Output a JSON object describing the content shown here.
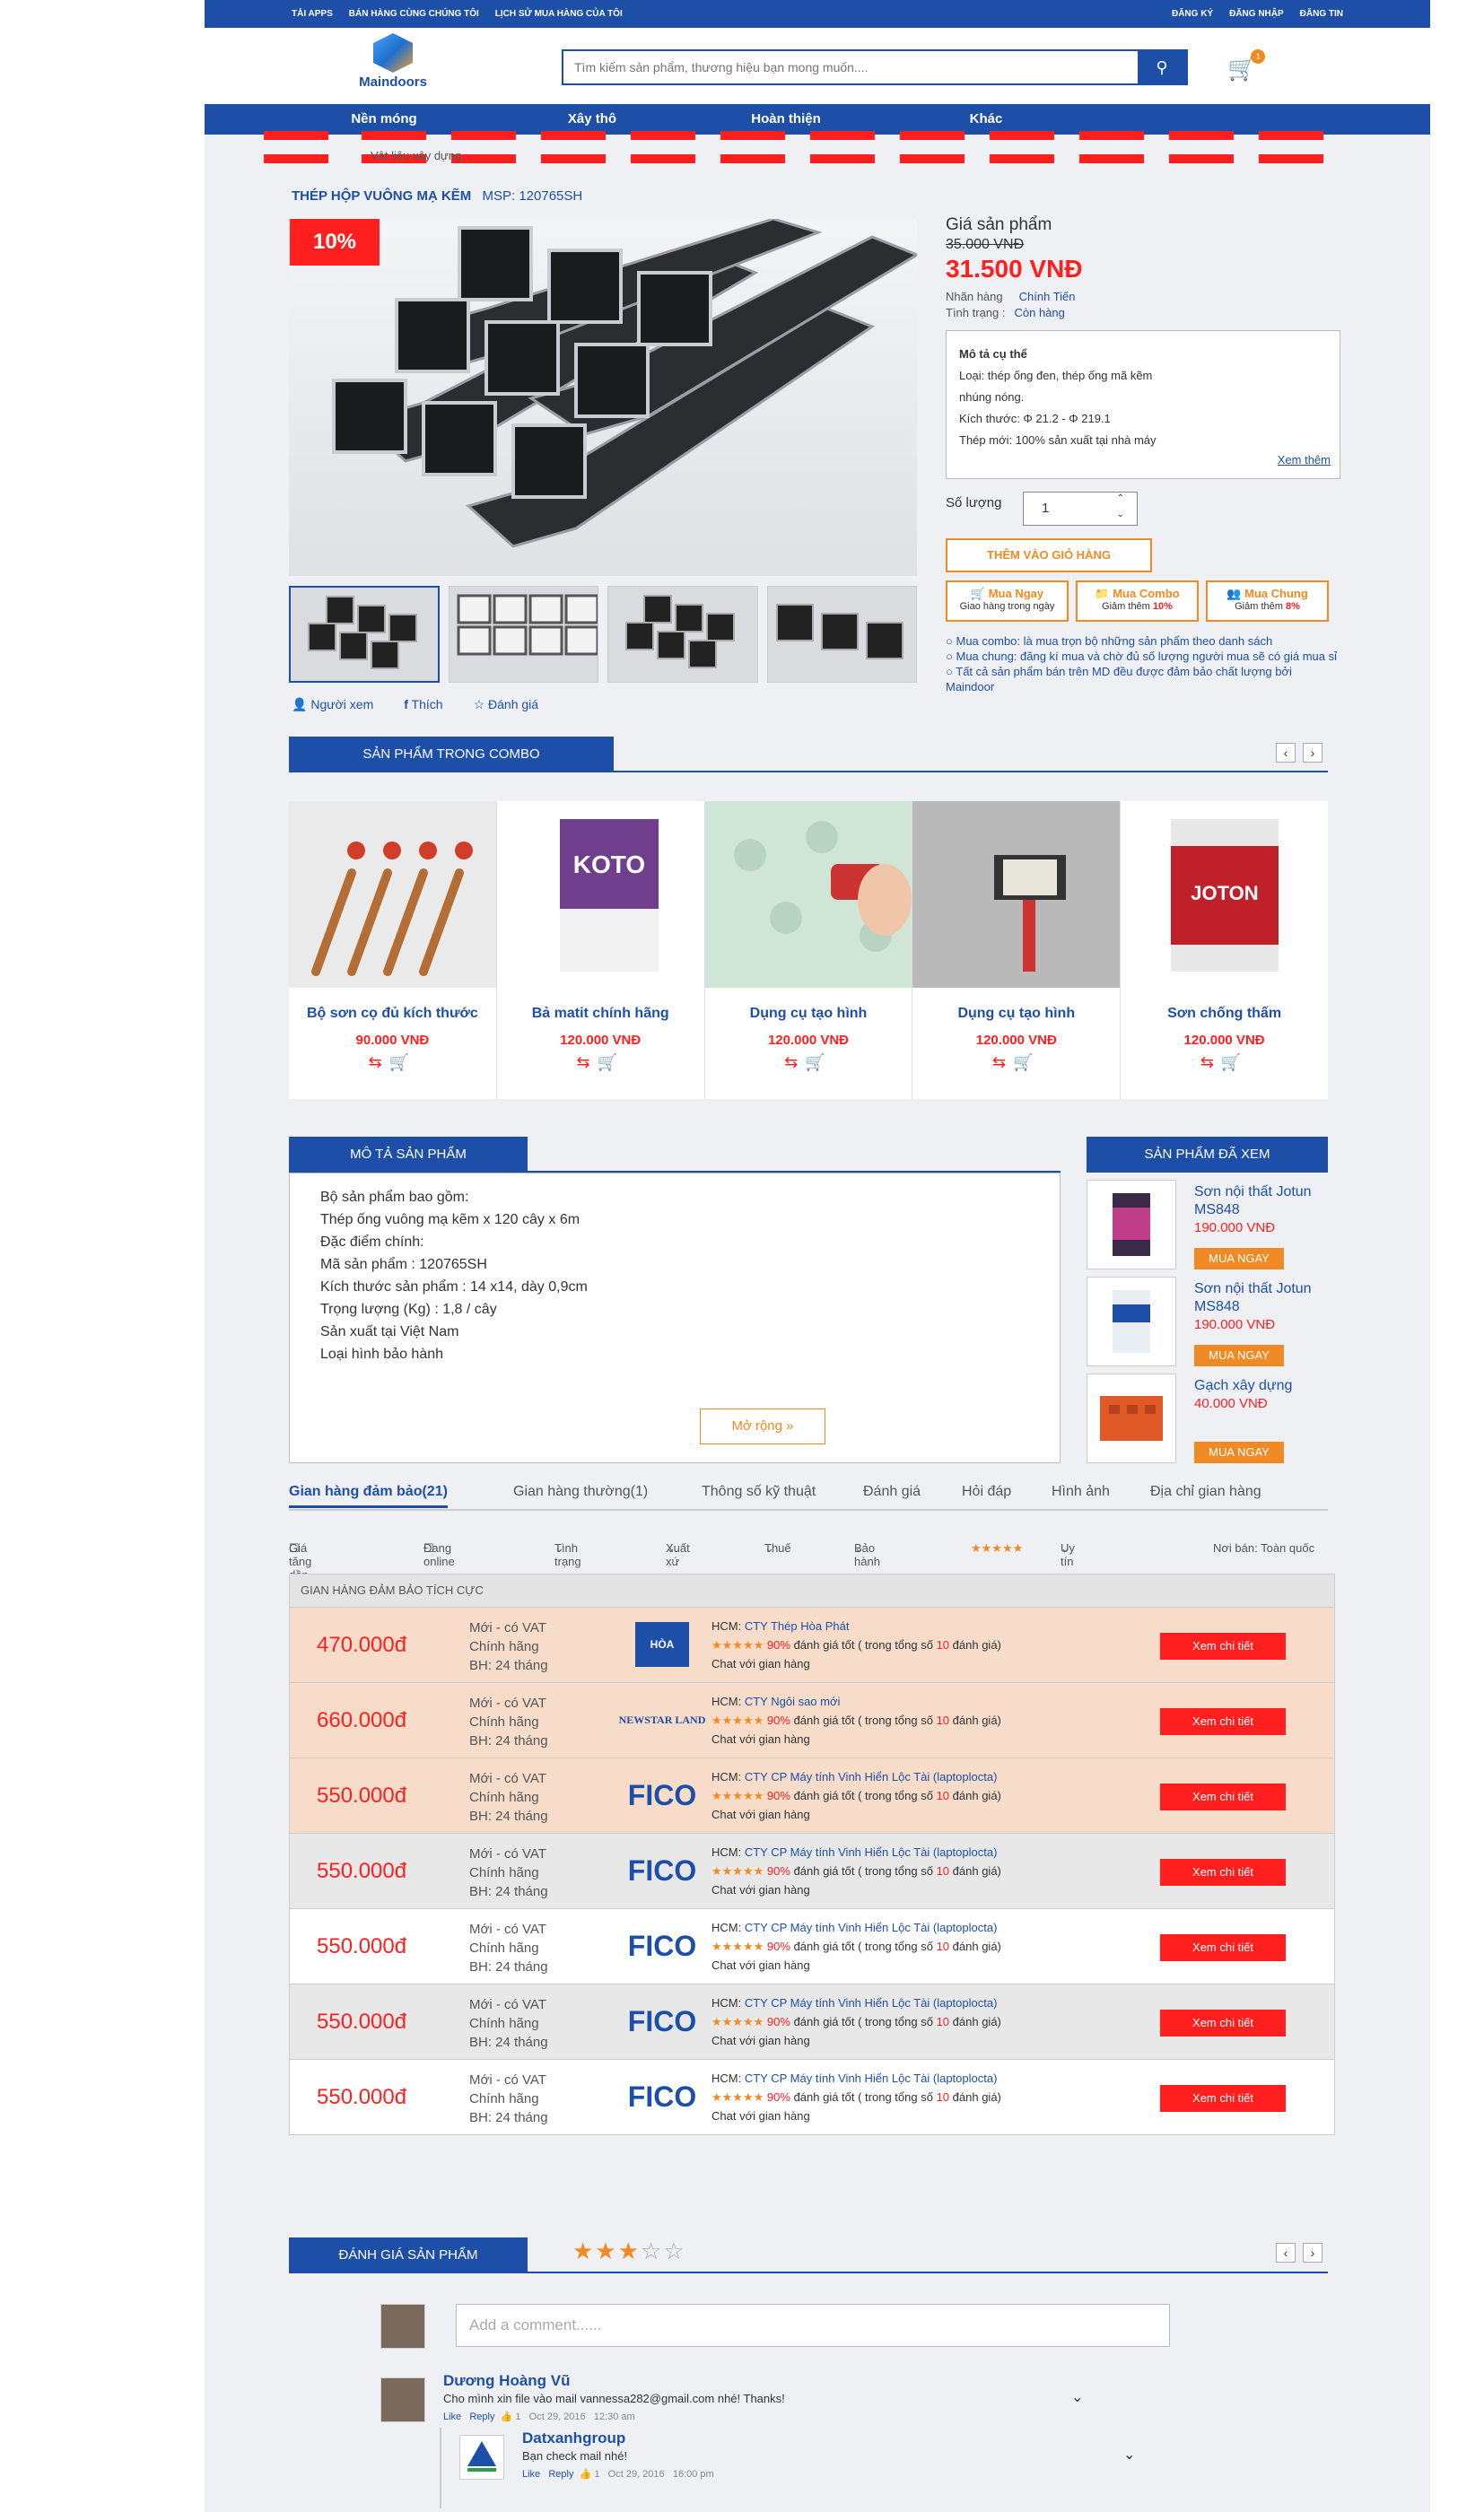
{
  "topbar": {
    "left": [
      "TẢI APPS",
      "BÁN HÀNG CÙNG CHÚNG TÔI",
      "LỊCH SỬ MUA HÀNG CỦA TÔI"
    ],
    "right": [
      "ĐĂNG KÝ",
      "ĐĂNG NHẬP",
      "ĐĂNG TIN"
    ]
  },
  "logo": {
    "text": "Maindoors"
  },
  "search": {
    "placeholder": "Tìm kiếm sản phẩm, thương hiệu bạn mong muốn....",
    "button_icon": "search-icon"
  },
  "cart": {
    "count": "1"
  },
  "nav": [
    "Nền móng",
    "Xây thô",
    "Hoàn thiện",
    "Khác"
  ],
  "breadcrumb": "Vật liệu xây dựng",
  "product": {
    "title": "THÉP HỘP VUÔNG MẠ KẼM",
    "msp_label": "MSP:",
    "msp": "120765SH",
    "discount": "10%",
    "price_label": "Giá sản phẩm",
    "old_price": "35.000 VNĐ",
    "new_price": "31.500 VNĐ",
    "brand_label": "Nhãn hàng",
    "brand": "Chính Tiến",
    "status_label": "Tình trạng :",
    "status": "Còn hàng",
    "desc_title": "Mô tả cụ thể",
    "desc_lines": [
      "Loại: thép ống đen, thép ống mã kẽm",
      "nhúng nóng.",
      "Kích thước: Φ 21.2 - Φ 219.1",
      "Thép mới: 100% sản xuất tại nhà máy"
    ],
    "see_more": "Xem thêm",
    "qty_label": "Số lượng",
    "qty_value": "1",
    "add_to_cart": "THÊM VÀO GIỎ HÀNG",
    "buy_now": {
      "title": "Mua Ngay",
      "sub": "Giao hàng trong ngày"
    },
    "buy_combo": {
      "title": "Mua Combo",
      "sub": "Giảm thêm",
      "rate": "10%"
    },
    "buy_group": {
      "title": "Mua Chung",
      "sub": "Giảm thêm",
      "rate": "8%"
    },
    "notes": [
      "Mua combo: là mua trọn bộ những sản phẩm theo danh sách",
      "Mua chung: đăng kí mua và chờ đủ số lượng người mua sẽ có giá mua sỉ",
      "Tất cả sản phẩm bán trên MD đều được đảm bảo chất lượng bởi Maindoor"
    ],
    "actions": [
      "Người xem",
      "Thích",
      "Đánh giá"
    ]
  },
  "combo": {
    "title": "SẢN PHẨM TRONG COMBO",
    "items": [
      {
        "name": "Bộ sơn cọ đủ kích thước",
        "price": "90.000 VNĐ"
      },
      {
        "name": "Bả matit chính hãng",
        "price": "120.000 VNĐ"
      },
      {
        "name": "Dụng cụ tạo hình",
        "price": "120.000 VNĐ"
      },
      {
        "name": "Dụng cụ tạo hình",
        "price": "120.000 VNĐ"
      },
      {
        "name": "Sơn chống thấm",
        "price": "120.000 VNĐ"
      }
    ]
  },
  "description": {
    "title": "MÔ TẢ SẢN PHẨM",
    "lines": [
      "Bộ sản phẩm bao gồm:",
      "Thép ống vuông mạ kẽm x 120 cây x 6m",
      "Đặc điểm chính:",
      "Mã sản phẩm : 120765SH",
      "Kích thước sản phẩm : 14 x14, dày 0,9cm",
      "Trọng lượng (Kg) : 1,8 / cây",
      "Sản xuất tại Việt Nam",
      "Loại hình bảo hành"
    ],
    "expand": "Mở rộng"
  },
  "viewed": {
    "title": "SẢN PHẨM ĐÃ XEM",
    "items": [
      {
        "name": "Sơn nội thất Jotun MS848",
        "price": "190.000 VNĐ",
        "btn": "MUA NGAY"
      },
      {
        "name": "Sơn nội thất Jotun MS848",
        "price": "190.000 VNĐ",
        "btn": "MUA NGAY"
      },
      {
        "name": "Gạch xây dựng",
        "price": "40.000 VNĐ",
        "btn": "MUA NGAY"
      }
    ]
  },
  "tabs": [
    "Gian hàng đảm bảo(21)",
    "Gian hàng thường(1)",
    "Thông số kỹ thuật",
    "Đánh giá",
    "Hỏi đáp",
    "Hình ảnh",
    "Địa chỉ gian hàng"
  ],
  "filters": {
    "price_asc": "Giá tăng dần",
    "online": "Đang online",
    "condition": "Tình trạng",
    "handling": "Xuất xứ",
    "tax": "Thuế",
    "warranty": "Bảo hành",
    "trust": "Uy tín",
    "seller": "Nơi bán: Toàn quốc"
  },
  "shops": {
    "header": "GIAN HÀNG ĐẢM BẢO TÍCH CỰC",
    "cond": [
      "Mới - có VAT",
      "Chính hãng",
      "BH: 24 tháng"
    ],
    "rating_text": "90%",
    "rating_mid": "đánh giá tốt ( trong tổng số",
    "rating_count": "10",
    "rating_end": "đánh giá)",
    "chat": "Chat với gian hàng",
    "btn": "Xem chi tiết",
    "rows": [
      {
        "price": "470.000đ",
        "brand": "HÒA PHÁT",
        "company": "CTY Thép Hòa Phát"
      },
      {
        "price": "660.000đ",
        "brand": "NEWSTAR LAND",
        "company": "CTY Ngôi sao mới"
      },
      {
        "price": "550.000đ",
        "brand": "FICO",
        "company": "CTY CP Máy tính Vinh Hiển Lộc Tài (laptoplocta)"
      },
      {
        "price": "550.000đ",
        "brand": "FICO",
        "company": "CTY CP Máy tính Vinh Hiển Lộc Tài (laptoplocta)"
      },
      {
        "price": "550.000đ",
        "brand": "FICO",
        "company": "CTY CP Máy tính Vinh Hiển Lộc Tài (laptoplocta)"
      },
      {
        "price": "550.000đ",
        "brand": "FICO",
        "company": "CTY CP Máy tính Vinh Hiển Lộc Tài (laptoplocta)"
      },
      {
        "price": "550.000đ",
        "brand": "FICO",
        "company": "CTY CP Máy tính Vinh Hiển Lộc Tài (laptoplocta)"
      }
    ],
    "city": "HCM:"
  },
  "review": {
    "title": "ĐÁNH GIÁ SẢN PHẨM",
    "stars": "3",
    "placeholder": "Add a comment......",
    "comments": [
      {
        "name": "Dương Hoàng Vũ",
        "text": "Cho mình xin file vào mail vannessa282@gmail.com nhé! Thanks!",
        "like": "Like",
        "reply": "Reply",
        "count": "1",
        "date": "Oct 29, 2016",
        "time": "12:30 am"
      },
      {
        "name": "Datxanhgroup",
        "text": "Bạn check mail nhé!",
        "like": "Like",
        "reply": "Reply",
        "count": "1",
        "date": "Oct 29, 2016",
        "time": "16:00 pm"
      }
    ]
  },
  "colors": {
    "primary": "#1e4fa8",
    "accent": "#f08a24",
    "red": "#ff1f1f"
  }
}
